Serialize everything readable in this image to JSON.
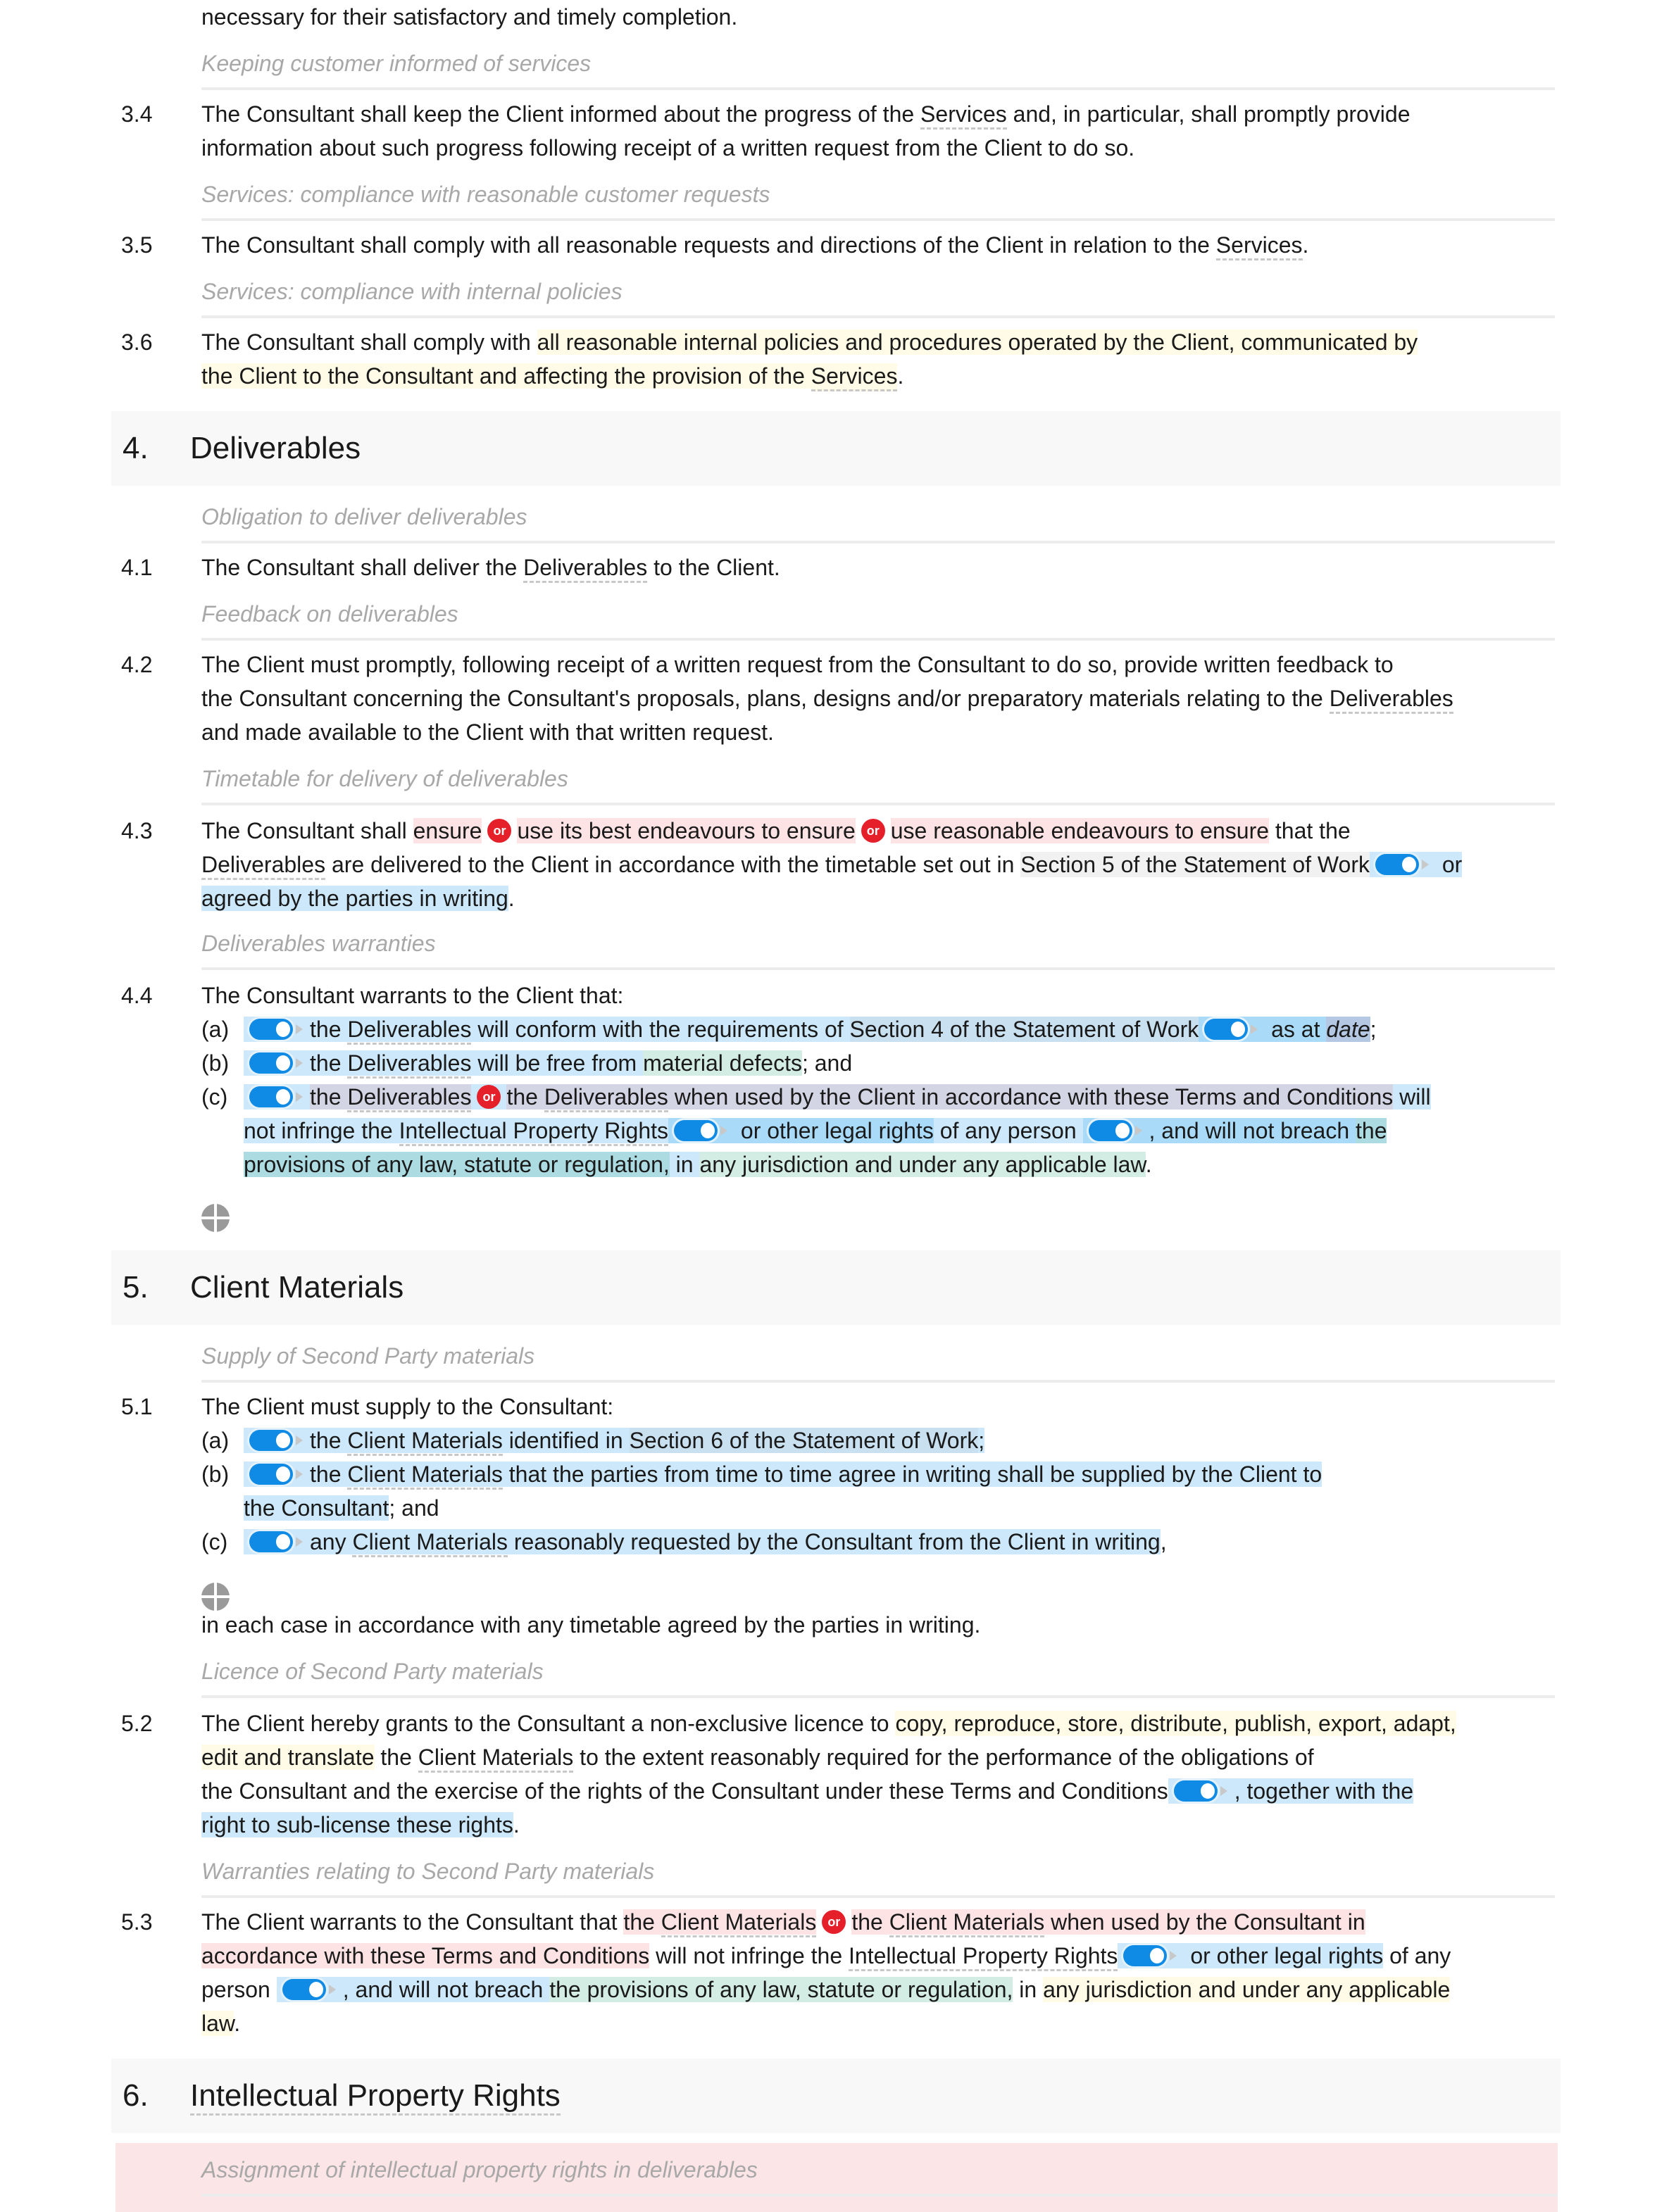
{
  "intro_line": "necessary for their satisfactory and timely completion.",
  "clauses": {
    "c3_4": {
      "subheading": "Keeping customer informed of services",
      "number": "3.4",
      "l1_a": "The Consultant shall keep the Client informed about the progress of the ",
      "l1_term": "Services",
      "l1_b": " and, in particular, shall promptly provide",
      "l2": "information about such progress following receipt of a written request from the Client to do so."
    },
    "c3_5": {
      "subheading": "Services: compliance with reasonable customer requests",
      "number": "3.5",
      "l1_a": "The Consultant shall comply with all reasonable requests and directions of the Client in relation to the ",
      "l1_term": "Services",
      "l1_b": "."
    },
    "c3_6": {
      "subheading": "Services: compliance with internal policies",
      "number": "3.6",
      "l1_a": "The Consultant shall comply with ",
      "l1_hl": "all reasonable internal policies and procedures operated by the Client, communicated by",
      "l2_hl": "the Client to the Consultant and affecting the provision of the ",
      "l2_term": "Services",
      "l2_b": "."
    },
    "c4_1": {
      "subheading": "Obligation to deliver deliverables",
      "number": "4.1",
      "l1_a": "The Consultant shall deliver the ",
      "l1_term": "Deliverables",
      "l1_b": " to the Client."
    },
    "c4_2": {
      "subheading": "Feedback on deliverables",
      "number": "4.2",
      "l1": "The Client must promptly, following receipt of a written request from the Consultant to do so, provide written feedback to",
      "l2_a": "the Consultant concerning the Consultant's proposals, plans, designs and/or preparatory materials relating to the ",
      "l2_term": "Deliverables",
      "l3": "and made available to the Client with that written request."
    },
    "c4_3": {
      "subheading": "Timetable for delivery of deliverables",
      "number": "4.3",
      "l1_a": "The Consultant shall ",
      "opt1": "ensure",
      "opt2": "use its best endeavours to ensure",
      "opt3": "use reasonable endeavours to ensure",
      "l1_b": " that the",
      "l2_term": "Deliverables",
      "l2_a": " are delivered to the Client in accordance with the timetable set out in ",
      "l2_ref": "Section 5 of the Statement of Work",
      "l2_or": " or",
      "l3_hl": "agreed by the parties in writing",
      "l3_b": "."
    },
    "c4_4": {
      "subheading": "Deliverables warranties",
      "number": "4.4",
      "intro": "The Consultant warrants to the Client that:",
      "a_label": "(a)",
      "a_1": "the ",
      "a_term": "Deliverables",
      "a_2": " will conform with the requirements of ",
      "a_ref": "Section 4 of the Statement of Work",
      "a_3": " as at ",
      "a_ph": "date",
      "a_4": ";",
      "b_label": "(b)",
      "b_1": "the ",
      "b_term": "Deliverables",
      "b_2": " will be free from ",
      "b_hl": "material defects",
      "b_3": "; and",
      "c_label": "(c)",
      "c_opt1_a": "the ",
      "c_opt1_term": "Deliverables",
      "c_opt2_a": "the ",
      "c_opt2_term": "Deliverables",
      "c_opt2_b": " when used by the Client in accordance with these Terms and Conditions",
      "c_1": " will",
      "c_l2_a": "not infringe the ",
      "c_l2_term": "Intellectual Property Rights",
      "c_l2_b": " or other legal rights",
      "c_l2_c": " of any person ",
      "c_l2_d": ", and will not breach ",
      "c_l2_e": "the",
      "c_l3_hl": "provisions of any law, statute or regulation,",
      "c_l3_a": " in ",
      "c_l3_hl2": "any jurisdiction and under any applicable law",
      "c_l3_b": "."
    },
    "c5_1": {
      "subheading": "Supply of Second Party materials",
      "number": "5.1",
      "intro": "The Client must supply to the Consultant:",
      "a_label": "(a)",
      "a_1": "the ",
      "a_term": "Client Materials",
      "a_2": " identified in ",
      "a_ref": "Section 6 of the Statement of Work",
      "a_3": ";",
      "b_label": "(b)",
      "b_1": "the ",
      "b_term": "Client Materials",
      "b_2": " that the parties from time to time agree in writing shall be supplied by the Client to",
      "b_l2": "the Consultant",
      "b_l2_b": "; and",
      "c_label": "(c)",
      "c_1": "any ",
      "c_term": "Client Materials",
      "c_2": " reasonably requested by the Consultant from the Client in writing",
      "c_3": ",",
      "outro": "in each case in accordance with any timetable agreed by the parties in writing."
    },
    "c5_2": {
      "subheading": "Licence of Second Party materials",
      "number": "5.2",
      "l1_a": "The Client hereby grants to the Consultant a non-exclusive licence to ",
      "l1_hl": "copy, reproduce, store, distribute, publish, export, adapt,",
      "l2_hl": "edit and translate",
      "l2_a": " the ",
      "l2_term": "Client Materials",
      "l2_b": " to the extent reasonably required for the performance of the obligations of",
      "l3_a": "the Consultant and the exercise of the rights of the Consultant under these Terms and Conditions",
      "l3_b": ", together with the",
      "l4_hl": "right to sub-license these rights",
      "l4_b": "."
    },
    "c5_3": {
      "subheading": "Warranties relating to Second Party materials",
      "number": "5.3",
      "l1_a": "The Client warrants to the Consultant that ",
      "opt1_a": "the ",
      "opt1_term": "Client Materials",
      "opt2_a": "the ",
      "opt2_term": "Client Materials",
      "opt2_b": " when used by the Consultant in",
      "l2_opt2": "accordance with these Terms and Conditions",
      "l2_a": " will not infringe the ",
      "l2_term": "Intellectual Property Rights",
      "l2_b": " or other legal rights",
      "l2_c": " of any",
      "l3_a": "person ",
      "l3_b": ", and will not breach ",
      "l3_hl": "the provisions of any law, statute or regulation,",
      "l3_c": " in ",
      "l3_hl2": "any jurisdiction and under any applicable",
      "l4_hl2": "law",
      "l4_b": "."
    }
  },
  "sections": {
    "s4": {
      "number": "4.",
      "title": "Deliverables"
    },
    "s5": {
      "number": "5.",
      "title": "Client Materials"
    },
    "s6": {
      "number": "6.",
      "title": "Intellectual Property Rights"
    }
  },
  "c6_1": {
    "subheading": "Assignment of intellectual property rights in deliverables"
  },
  "badges": {
    "or_label": "or"
  },
  "colors": {
    "or_badge": "#e5202a",
    "toggle_on": "#0f8be6",
    "optional_highlight": "#cce8fa",
    "alternative_highlight": "#fde3e4",
    "variable_highlight": "#fffbe6"
  }
}
